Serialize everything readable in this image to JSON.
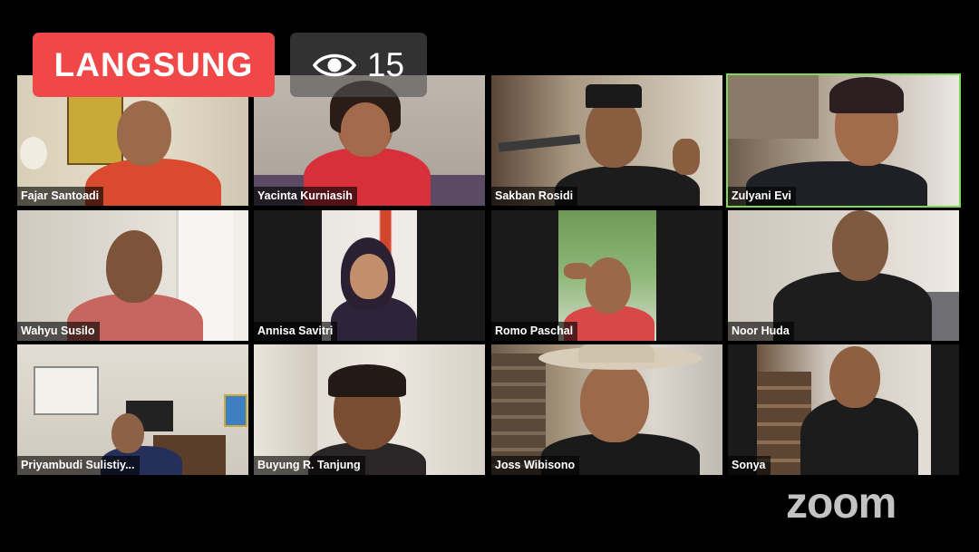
{
  "badge": {
    "live_label": "LANGSUNG",
    "viewer_count": "15",
    "viewer_icon": "eye-icon"
  },
  "brand": {
    "logo_text": "zoom"
  },
  "accent": {
    "active_speaker_border": "#7ed957",
    "live_badge": "#f04848"
  },
  "participants": [
    {
      "name": "Fajar Santoadi"
    },
    {
      "name": "Yacinta Kurniasih"
    },
    {
      "name": "Sakban Rosidi"
    },
    {
      "name": "Zulyani Evi"
    },
    {
      "name": "Wahyu Susilo"
    },
    {
      "name": "Annisa Savitri"
    },
    {
      "name": "Romo Paschal"
    },
    {
      "name": "Noor Huda"
    },
    {
      "name": "Priyambudi Sulistiy..."
    },
    {
      "name": "Buyung R. Tanjung"
    },
    {
      "name": "Joss Wibisono"
    },
    {
      "name": "Sonya"
    }
  ]
}
